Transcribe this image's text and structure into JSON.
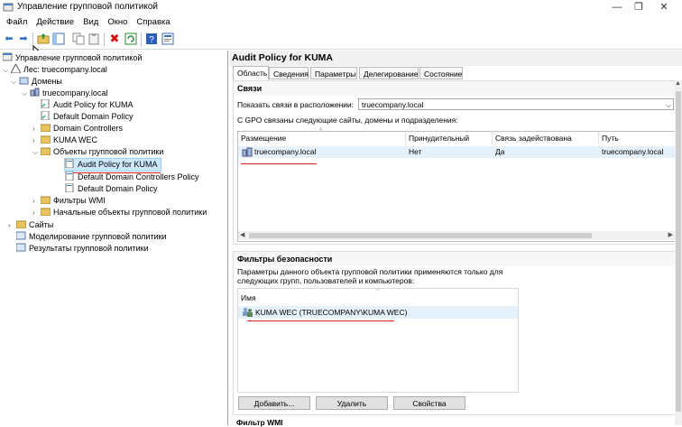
{
  "window": {
    "title": "Управление групповой политикой"
  },
  "menu": [
    "Файл",
    "Действие",
    "Вид",
    "Окно",
    "Справка"
  ],
  "tree": {
    "root": "Управление групповой политикой",
    "forest": "Лес: truecompany.local",
    "domains": "Домены",
    "domain": "truecompany.local",
    "items": {
      "audit": "Audit Policy for KUMA",
      "ddp": "Default Domain Policy",
      "dc": "Domain Controllers",
      "wec": "KUMA WEC",
      "gpo": "Объекты групповой политики",
      "gpo_audit": "Audit Policy for KUMA",
      "gpo_ddcp": "Default Domain Controllers Policy",
      "gpo_ddp": "Default Domain Policy",
      "wmi": "Фильтры WMI",
      "starter": "Начальные объекты групповой политики",
      "sites": "Сайты",
      "modeling": "Моделирование групповой политики",
      "results": "Результаты групповой политики"
    }
  },
  "right": {
    "title": "Audit Policy for KUMA",
    "tabs": [
      "Область",
      "Сведения",
      "Параметры",
      "Делегирование",
      "Состояние"
    ],
    "links": {
      "header": "Связи",
      "show_label": "Показать связи в расположении:",
      "show_value": "truecompany.local",
      "linked_text": "С GPO связаны следующие сайты, домены и подразделения:",
      "columns": [
        "Размещение",
        "Принудительный",
        "Связь задействована",
        "Путь"
      ],
      "row": [
        "truecompany.local",
        "Нет",
        "Да",
        "truecompany.local"
      ]
    },
    "security": {
      "header": "Фильтры безопасности",
      "desc1": "Параметры данного объекта групповой политики применяются только для",
      "desc2": "следующих групп, пользователей и компьютеров:",
      "column": "Имя",
      "row": "KUMA WEC (TRUECOMPANY\\KUMA WEC)",
      "buttons": [
        "Добавить...",
        "Удалить",
        "Свойства"
      ]
    },
    "wmi_header": "Фильтр WMI"
  }
}
